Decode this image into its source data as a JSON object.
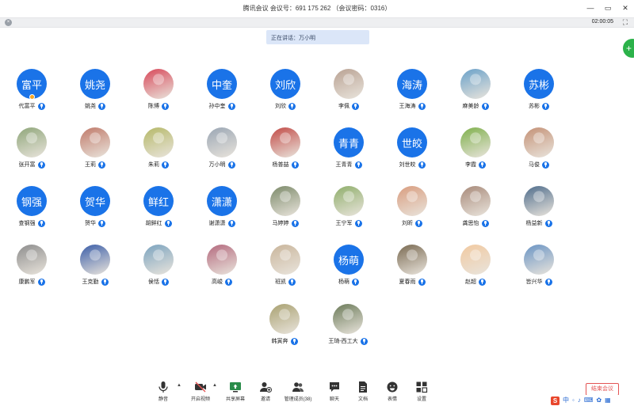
{
  "window": {
    "title": "腾讯会议  会议号：691 175 262  （会议密码：0316）",
    "controls": {
      "minimize": "—",
      "maximize": "▭",
      "close": "✕"
    }
  },
  "infobar": {
    "timer": "02:00:05",
    "close_glyph": "×",
    "fullscreen_glyph": "⛶"
  },
  "speaking": {
    "text": "正在讲话：万小明"
  },
  "floating": {
    "glyph": "+"
  },
  "participants": [
    {
      "name": "代富平",
      "avatar_text": "富平",
      "avatar_kind": "text",
      "host": true
    },
    {
      "name": "姚尧",
      "avatar_text": "姚尧",
      "avatar_kind": "text"
    },
    {
      "name": "陈博",
      "avatar_kind": "photo",
      "photo_color": "#d8495a"
    },
    {
      "name": "孙中奎",
      "avatar_text": "中奎",
      "avatar_kind": "text"
    },
    {
      "name": "刘欣",
      "avatar_text": "刘欣",
      "avatar_kind": "text"
    },
    {
      "name": "李佩",
      "avatar_kind": "photo",
      "photo_color": "#b9a293"
    },
    {
      "name": "王海涛",
      "avatar_text": "海涛",
      "avatar_kind": "text"
    },
    {
      "name": "麻美龄",
      "avatar_kind": "photo",
      "photo_color": "#6aa1c9"
    },
    {
      "name": "苏彬",
      "avatar_text": "苏彬",
      "avatar_kind": "text"
    },
    {
      "name": "张开富",
      "avatar_kind": "photo",
      "photo_color": "#8fa67a"
    },
    {
      "name": "王莉",
      "avatar_kind": "photo",
      "photo_color": "#c07a6a"
    },
    {
      "name": "朱莉",
      "avatar_kind": "photo",
      "photo_color": "#b5b868"
    },
    {
      "name": "万小明",
      "avatar_kind": "photo",
      "photo_color": "#9aa6b4"
    },
    {
      "name": "杨普喆",
      "avatar_kind": "photo",
      "photo_color": "#c24b47"
    },
    {
      "name": "王青青",
      "avatar_text": "青青",
      "avatar_kind": "text"
    },
    {
      "name": "刘世皎",
      "avatar_text": "世皎",
      "avatar_kind": "text"
    },
    {
      "name": "李霞",
      "avatar_kind": "photo",
      "photo_color": "#7fb04c"
    },
    {
      "name": "马俊",
      "avatar_kind": "photo",
      "photo_color": "#c49176"
    },
    {
      "name": "查钢强",
      "avatar_text": "钢强",
      "avatar_kind": "text"
    },
    {
      "name": "贺华",
      "avatar_text": "贺华",
      "avatar_kind": "text"
    },
    {
      "name": "胡鲜红",
      "avatar_text": "鲜红",
      "avatar_kind": "text"
    },
    {
      "name": "谢潇潇",
      "avatar_text": "潇潇",
      "avatar_kind": "text"
    },
    {
      "name": "马婷婷",
      "avatar_kind": "photo",
      "photo_color": "#7c8a6a"
    },
    {
      "name": "王宁军",
      "avatar_kind": "photo",
      "photo_color": "#8fae6b"
    },
    {
      "name": "刘昕",
      "avatar_kind": "photo",
      "photo_color": "#d99d7f"
    },
    {
      "name": "龚思怡",
      "avatar_kind": "photo",
      "photo_color": "#a88a7a"
    },
    {
      "name": "杨益新",
      "avatar_kind": "photo",
      "photo_color": "#4f6d8c"
    },
    {
      "name": "康鹏军",
      "avatar_kind": "photo",
      "photo_color": "#8d8d8d"
    },
    {
      "name": "王克勤",
      "avatar_kind": "photo",
      "photo_color": "#3b5ea8"
    },
    {
      "name": "侯恬",
      "avatar_kind": "photo",
      "photo_color": "#7ba3bf"
    },
    {
      "name": "高峻",
      "avatar_kind": "photo",
      "photo_color": "#b46a7e"
    },
    {
      "name": "班凯",
      "avatar_kind": "photo",
      "photo_color": "#c9b59b"
    },
    {
      "name": "杨萌",
      "avatar_text": "杨萌",
      "avatar_kind": "text"
    },
    {
      "name": "夏春雨",
      "avatar_kind": "photo",
      "photo_color": "#7a6a52"
    },
    {
      "name": "赵超",
      "avatar_kind": "photo",
      "photo_color": "#f1c9a0"
    },
    {
      "name": "皆兴华",
      "avatar_kind": "photo",
      "photo_color": "#6a94c4"
    },
    {
      "name": "韩寅奔",
      "avatar_kind": "photo",
      "photo_color": "#a9a171"
    },
    {
      "name": "王琦-西工大",
      "avatar_kind": "photo",
      "photo_color": "#6c7b5a"
    }
  ],
  "toolbar": {
    "items": [
      {
        "label": "静音"
      },
      {
        "label": "开启视频"
      },
      {
        "label": "共享屏幕"
      },
      {
        "label": "邀请"
      },
      {
        "label": "管理成员(38)"
      },
      {
        "label": "聊天"
      },
      {
        "label": "文档"
      },
      {
        "label": "表情"
      },
      {
        "label": "设置"
      }
    ],
    "end_label": "结束会议"
  },
  "ime": {
    "logo": "S",
    "mode": "中"
  },
  "colors": {
    "accent": "#1a73e8",
    "end": "#e35454",
    "speaking_bg": "#dbe6f8"
  }
}
